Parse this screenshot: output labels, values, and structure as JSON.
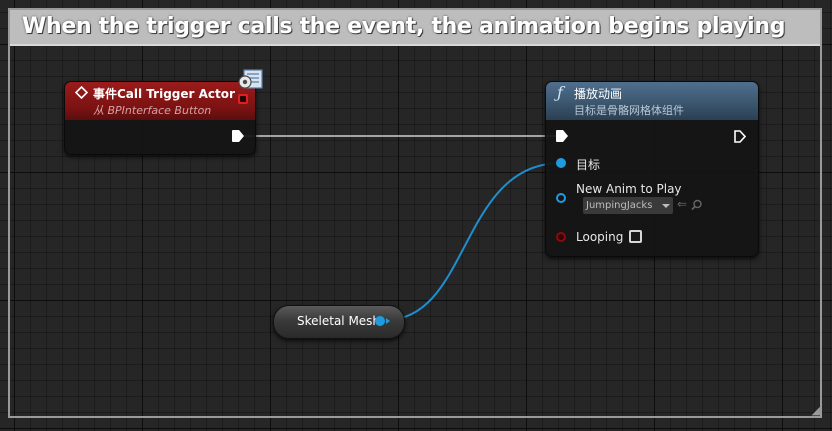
{
  "comment": {
    "title": "When the trigger calls the event, the animation begins playing"
  },
  "event_node": {
    "title": "事件Call Trigger Actor",
    "subtitle": "从 BPInterface Button",
    "icon": "diamond-event-icon",
    "badge_icon": "interface-badge-icon",
    "header_color": "#8b1717"
  },
  "function_node": {
    "title": "播放动画",
    "subtitle": "目标是骨骼网格体组件",
    "icon": "function-icon",
    "header_color": "#46627f",
    "pins": {
      "target": "目标",
      "new_anim": "New Anim to Play",
      "looping": "Looping"
    },
    "new_anim_value": "JumpingJacks"
  },
  "variable_node": {
    "label": "Skeletal Mesh",
    "pin_color": "#1fa0e0"
  },
  "colors": {
    "exec_wire": "#d0d0d0",
    "object_wire": "#1f8fcf",
    "looping_pin": "#7a0b0b"
  }
}
